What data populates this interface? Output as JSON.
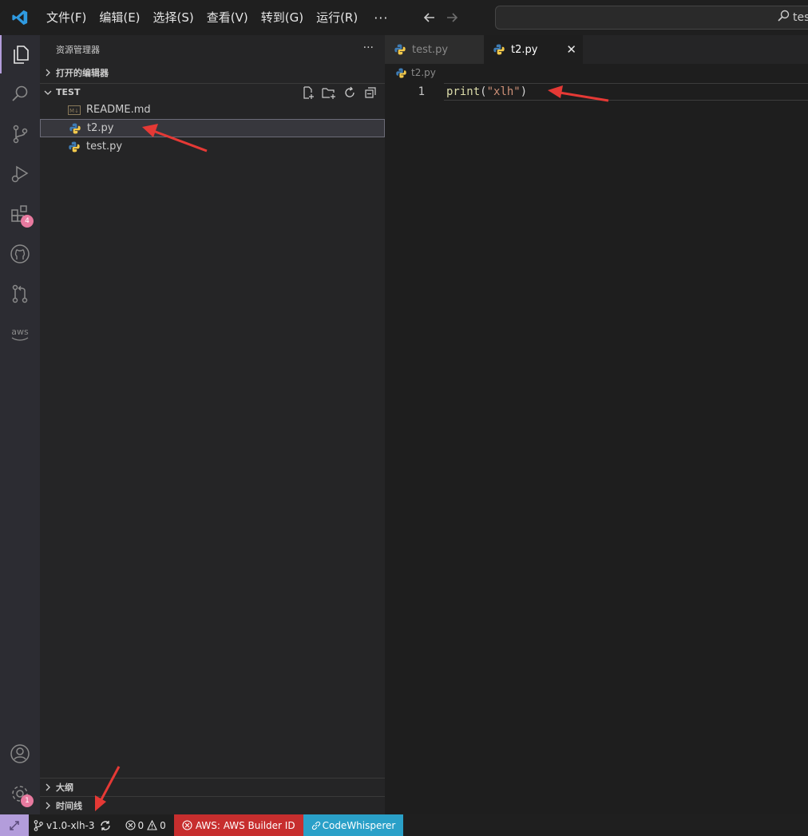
{
  "menu": [
    "文件(F)",
    "编辑(E)",
    "选择(S)",
    "查看(V)",
    "转到(G)",
    "运行(R)"
  ],
  "menu_more": "···",
  "search": {
    "text": "tes"
  },
  "activity": {
    "extensions_badge": "4",
    "settings_badge": "1"
  },
  "sidebar": {
    "title": "资源管理器",
    "more": "···",
    "open_editors": "打开的编辑器",
    "folder": "TEST",
    "files": [
      {
        "name": "README.md",
        "type": "markdown"
      },
      {
        "name": "t2.py",
        "type": "python"
      },
      {
        "name": "test.py",
        "type": "python"
      }
    ],
    "outline": "大纲",
    "timeline": "时间线"
  },
  "tabs": [
    {
      "label": "test.py",
      "active": false
    },
    {
      "label": "t2.py",
      "active": true
    }
  ],
  "editor": {
    "breadcrumb": "t2.py",
    "line_number": "1",
    "code": {
      "fn": "print",
      "open": "(",
      "str": "\"xlh\"",
      "close": ")"
    }
  },
  "status": {
    "branch": "v1.0-xlh-3",
    "errors": "0",
    "warnings": "0",
    "aws": "AWS: AWS Builder ID",
    "codewhisperer": "CodeWhisperer"
  },
  "colors": {
    "accent": "#b39ddb",
    "aws": "#c72e2e",
    "codewhisperer": "#2aa0c8",
    "arrow": "#e53935"
  }
}
